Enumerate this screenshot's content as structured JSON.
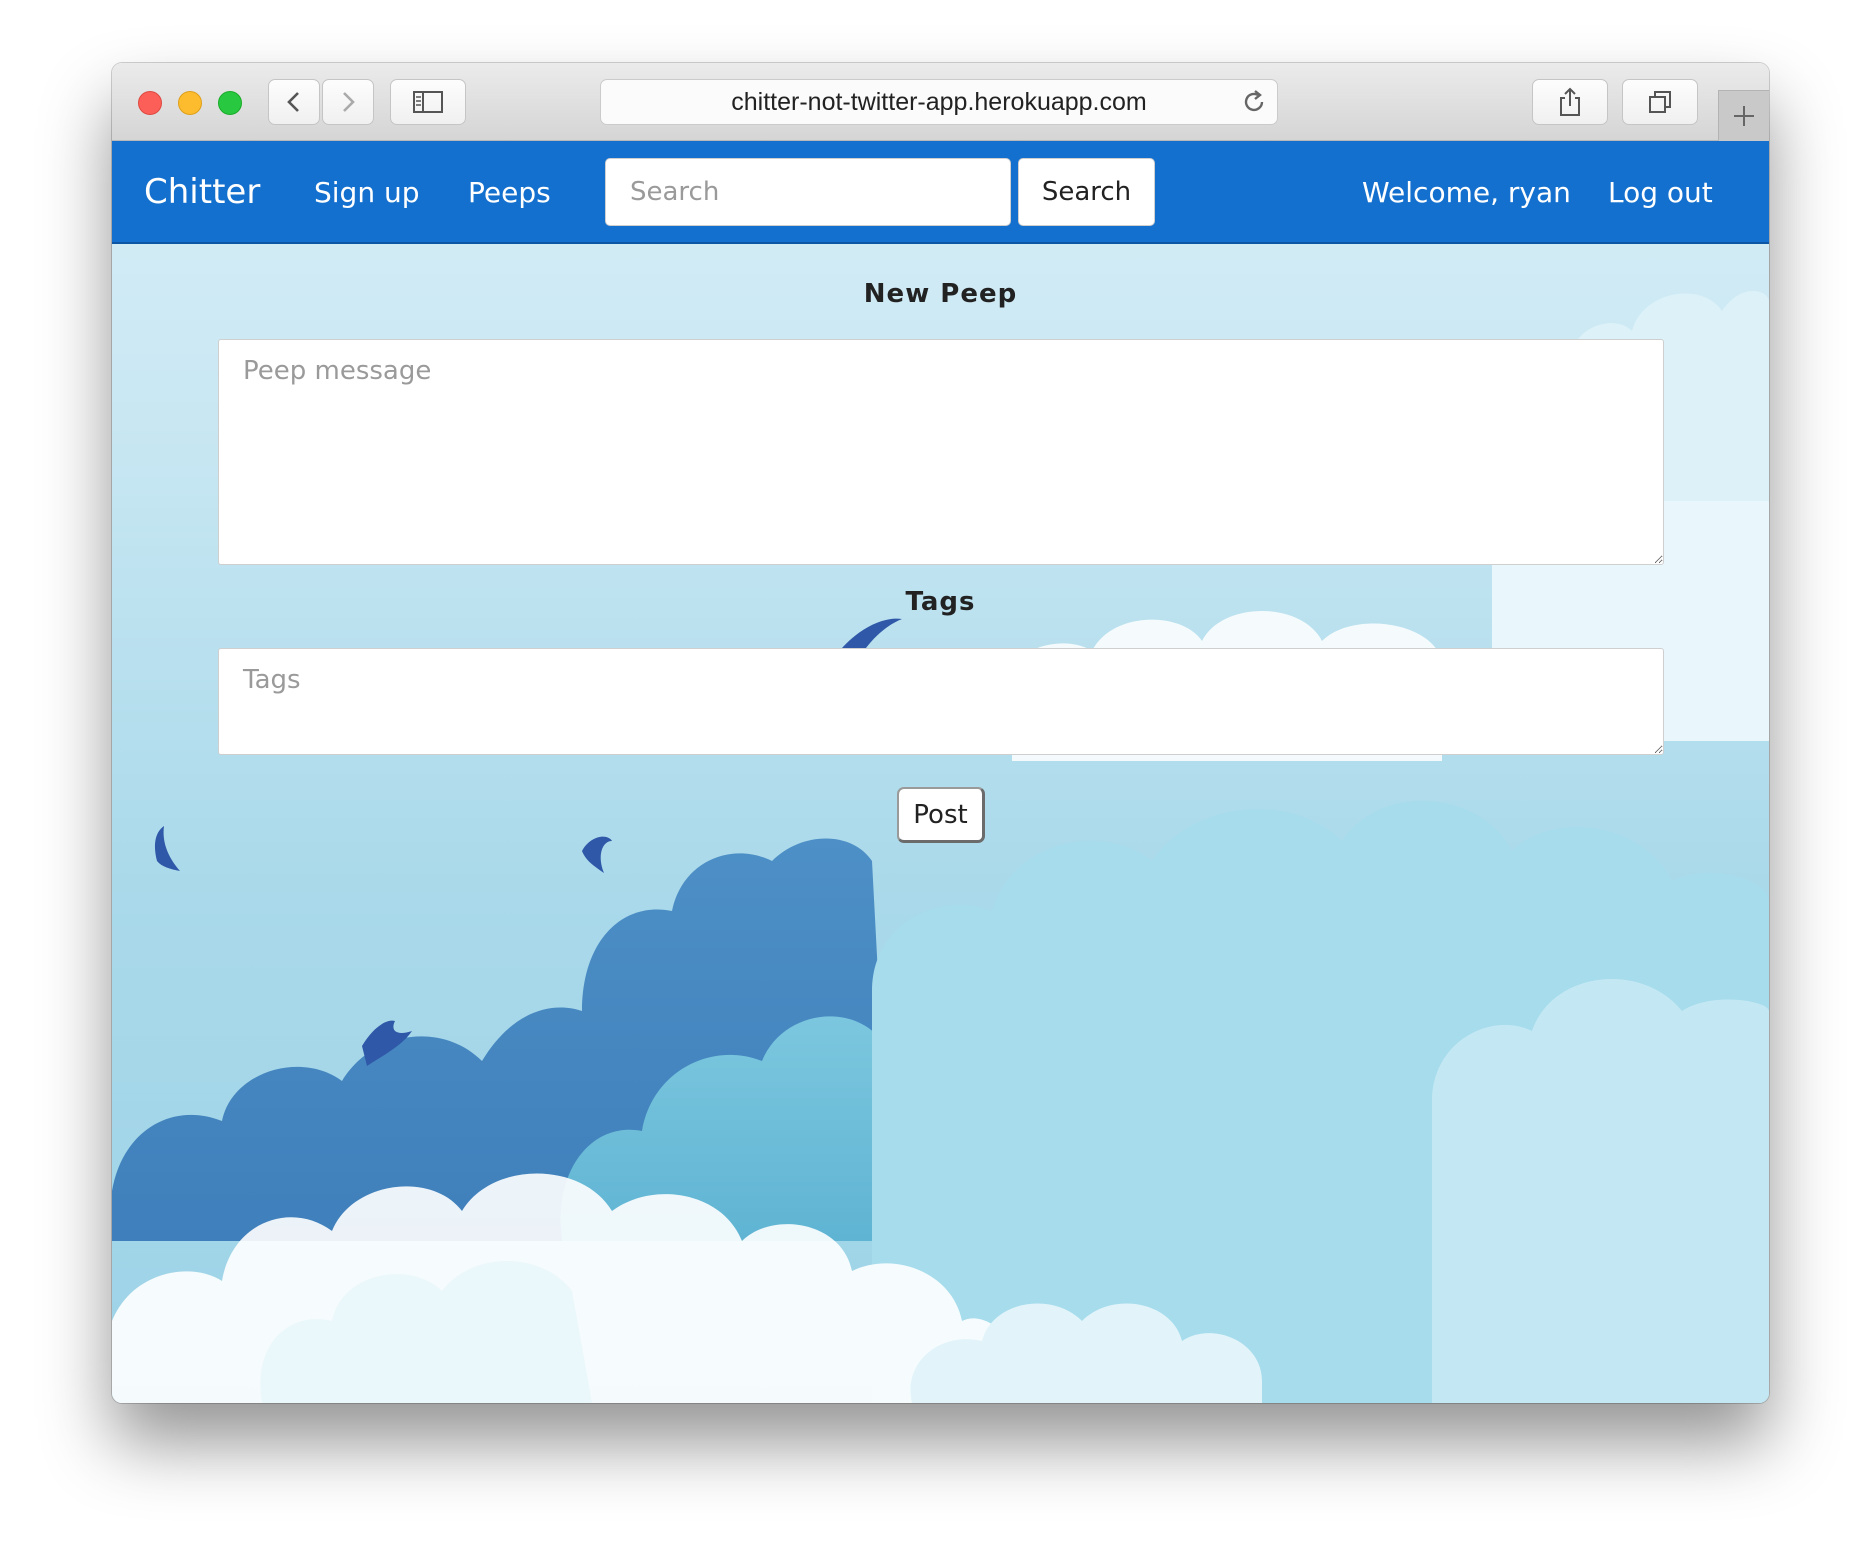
{
  "browser": {
    "url": "chitter-not-twitter-app.herokuapp.com",
    "icons": [
      "back-icon",
      "forward-icon",
      "sidebar-icon",
      "reload-icon",
      "share-icon",
      "tabs-icon",
      "new-tab-icon"
    ]
  },
  "navbar": {
    "brand": "Chitter",
    "signup": "Sign up",
    "peeps": "Peeps",
    "search_placeholder": "Search",
    "search_button": "Search",
    "welcome": "Welcome, ryan",
    "logout": "Log out",
    "color": "#1470ce"
  },
  "form": {
    "title": "New Peep",
    "message_placeholder": "Peep message",
    "tags_label": "Tags",
    "tags_placeholder": "Tags",
    "post_button": "Post"
  }
}
